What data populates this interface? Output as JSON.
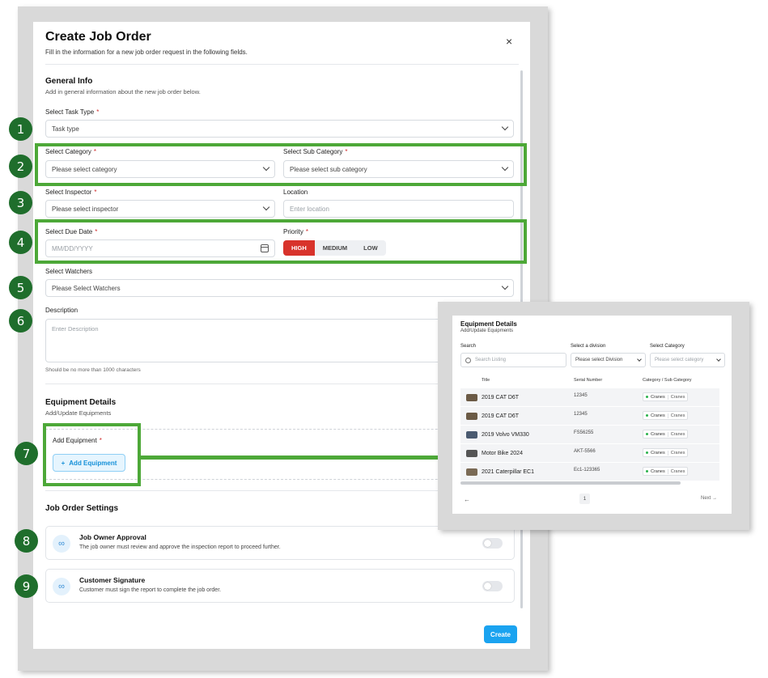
{
  "modal": {
    "title": "Create Job Order",
    "subtitle": "Fill in the information for a new job order request in the following fields.",
    "close_icon": "×",
    "create_label": "Create"
  },
  "general": {
    "title": "General Info",
    "subtitle": "Add in general information about the new job order below.",
    "task_type_label": "Select Task Type",
    "task_type_value": "Task type",
    "category_label": "Select Category",
    "category_placeholder": "Please select category",
    "subcategory_label": "Select Sub Category",
    "subcategory_placeholder": "Please select sub category",
    "inspector_label": "Select Inspector",
    "inspector_placeholder": "Please select inspector",
    "location_label": "Location",
    "location_placeholder": "Enter location",
    "due_date_label": "Select Due Date",
    "due_date_placeholder": "MM/DD/YYYY",
    "priority_label": "Priority",
    "priority_options": [
      "HIGH",
      "MEDIUM",
      "LOW"
    ],
    "priority_selected": "HIGH",
    "watchers_label": "Select Watchers",
    "watchers_placeholder": "Please Select Watchers",
    "description_label": "Description",
    "description_placeholder": "Enter Description",
    "description_hint": "Should be no more than 1000 characters",
    "required_mark": "*"
  },
  "equipment": {
    "title": "Equipment Details",
    "subtitle": "Add/Update Equipments",
    "add_label": "Add Equipment",
    "add_button": "Add Equipment",
    "plus": "+"
  },
  "settings": {
    "title": "Job Order Settings",
    "items": [
      {
        "title": "Job Owner Approval",
        "desc": "The job owner must review and approve the inspection report to proceed further.",
        "icon": "link-icon",
        "enabled": false
      },
      {
        "title": "Customer Signature",
        "desc": "Customer must sign the report to complete the job order.",
        "icon": "link-icon",
        "enabled": false
      }
    ]
  },
  "callouts": [
    "1",
    "2",
    "3",
    "4",
    "5",
    "6",
    "7",
    "8",
    "9"
  ],
  "equipment_panel": {
    "title": "Equipment Details",
    "subtitle": "Add/Update Equipments",
    "search_label": "Search",
    "search_placeholder": "Search Listing",
    "division_label": "Select a division",
    "division_placeholder": "Please select Division",
    "category_label": "Select Category",
    "category_placeholder": "Please select category",
    "columns": [
      "Title",
      "Serial Number",
      "Category / Sub Category"
    ],
    "rows": [
      {
        "title": "2019 CAT D6T",
        "serial": "12345",
        "category": "Cranes",
        "sub": "Cranes"
      },
      {
        "title": "2019 CAT D6T",
        "serial": "12345",
        "category": "Cranes",
        "sub": "Cranes"
      },
      {
        "title": "2019 Volvo VM330",
        "serial": "FS56255",
        "category": "Cranes",
        "sub": "Cranes"
      },
      {
        "title": "Motor Bike 2024",
        "serial": "AKT-5566",
        "category": "Cranes",
        "sub": "Cranes"
      },
      {
        "title": "2021 Caterpillar EC1",
        "serial": "Ec1-123365",
        "category": "Cranes",
        "sub": "Cranes"
      }
    ],
    "prev": "←",
    "page": "1",
    "next": "Next →"
  },
  "colors": {
    "accent": "#1aa3f0",
    "highlight": "#4da838",
    "callout": "#1f6e2c",
    "priority_high": "#d8332b"
  }
}
